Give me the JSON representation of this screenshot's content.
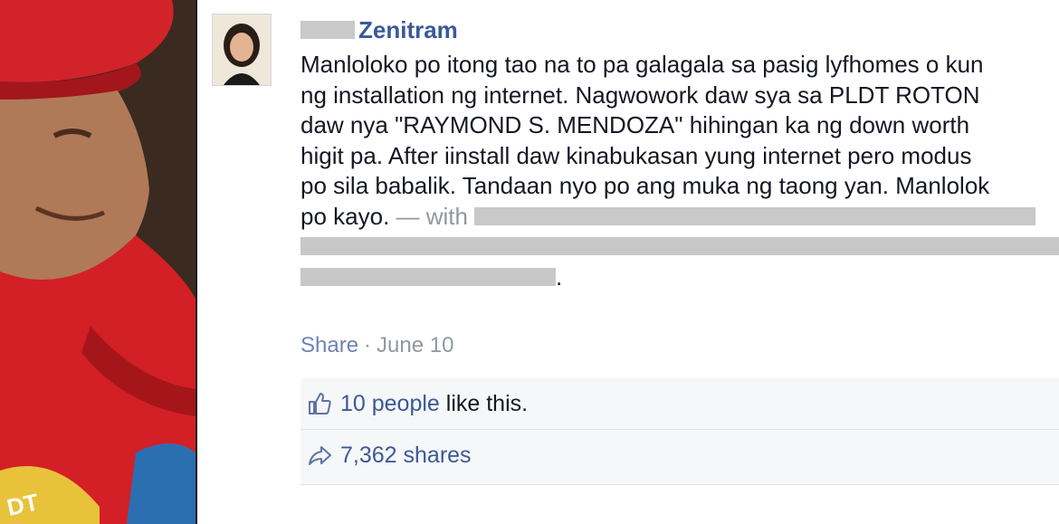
{
  "post": {
    "author_name": "Zenitram",
    "text_lines": [
      "Manloloko po itong tao na to pa galagala sa pasig lyfhomes o kun",
      "ng installation ng internet. Nagwowork daw sya sa PLDT ROTON",
      "daw nya \"RAYMOND S. MENDOZA\" hihingan ka ng down worth",
      "higit pa. After iinstall daw kinabukasan yung internet pero modus",
      "po sila babalik. Tandaan nyo po ang muka ng taong yan. Manlolok"
    ],
    "last_line_start": "po kayo.",
    "with_prefix": "— with",
    "end_period": "."
  },
  "meta": {
    "share_label": "Share",
    "separator": "·",
    "date": "June 10"
  },
  "ufi": {
    "likes_count_text": "10 people",
    "likes_suffix": " like this.",
    "shares_text": "7,362 shares"
  },
  "colors": {
    "link_blue": "#3b5998",
    "meta_gray": "#9197a3",
    "ufi_bg": "#f6f7f8"
  },
  "icons": {
    "like": "thumbs-up-icon",
    "share": "share-arrow-icon"
  }
}
